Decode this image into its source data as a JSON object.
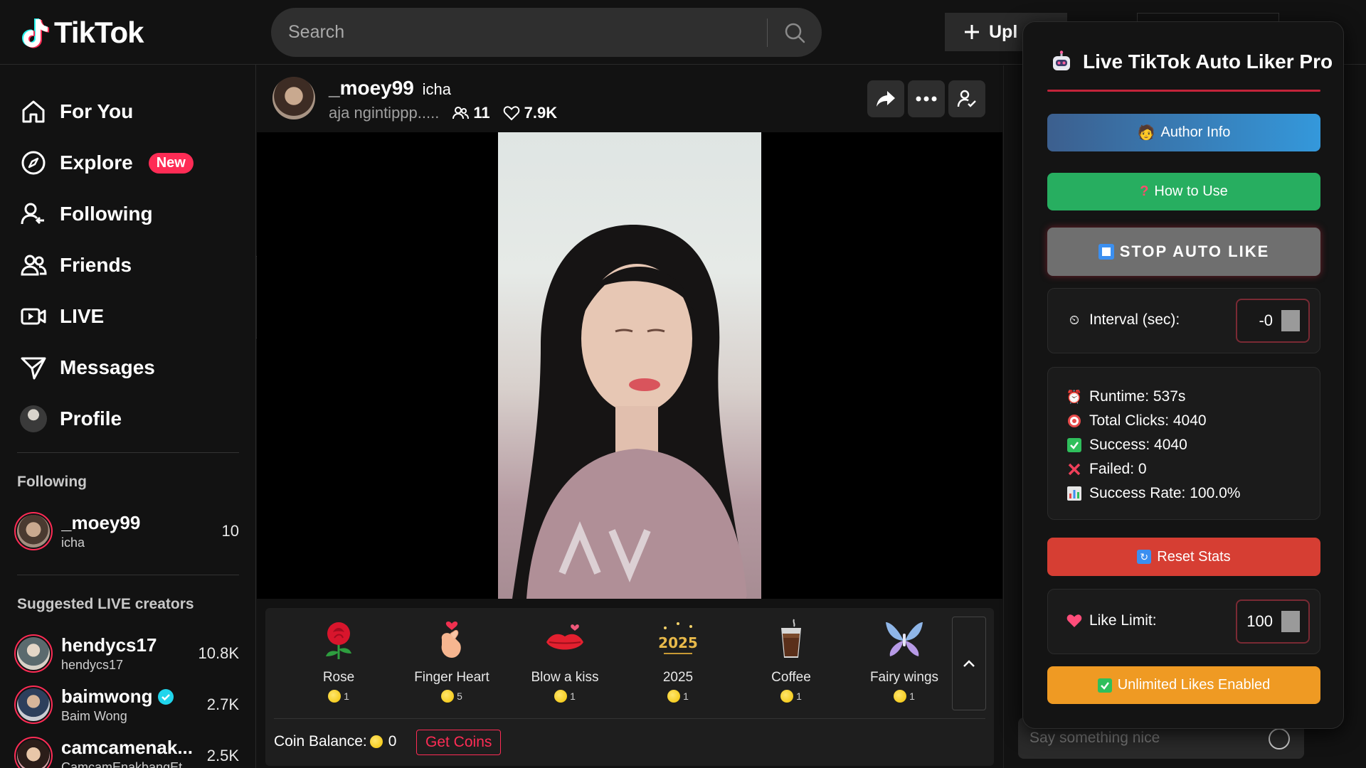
{
  "header": {
    "logo_text": "TikTok",
    "search_placeholder": "Search",
    "upload_label": "Upl"
  },
  "sidebar": {
    "nav": [
      {
        "label": "For You",
        "icon": "home-icon"
      },
      {
        "label": "Explore",
        "icon": "compass-icon",
        "badge": "New"
      },
      {
        "label": "Following",
        "icon": "following-icon"
      },
      {
        "label": "Friends",
        "icon": "friends-icon"
      },
      {
        "label": "LIVE",
        "icon": "live-icon"
      },
      {
        "label": "Messages",
        "icon": "messages-icon"
      },
      {
        "label": "Profile",
        "icon": "profile-avatar"
      }
    ],
    "following_heading": "Following",
    "following": [
      {
        "name": "_moey99",
        "sub": "icha",
        "count": "10"
      }
    ],
    "suggested_heading": "Suggested LIVE creators",
    "suggested": [
      {
        "name": "hendycs17",
        "sub": "hendycs17",
        "count": "10.8K",
        "verified": false
      },
      {
        "name": "baimwong",
        "sub": "Baim Wong",
        "count": "2.7K",
        "verified": true
      },
      {
        "name": "camcamenak...",
        "sub": "CamcamEnakbangEt",
        "count": "2.5K",
        "verified": false
      }
    ]
  },
  "live": {
    "username": "_moey99",
    "nickname": "icha",
    "description": "aja ngintippp.....",
    "viewers": "11",
    "likes": "7.9K"
  },
  "gifts": [
    {
      "name": "Rose",
      "price": "1",
      "icon": "rose-icon"
    },
    {
      "name": "Finger Heart",
      "price": "5",
      "icon": "finger-heart-icon"
    },
    {
      "name": "Blow a kiss",
      "price": "1",
      "icon": "kiss-lips-icon"
    },
    {
      "name": "2025",
      "price": "1",
      "icon": "2025-icon"
    },
    {
      "name": "Coffee",
      "price": "1",
      "icon": "coffee-icon"
    },
    {
      "name": "Fairy wings",
      "price": "1",
      "icon": "fairy-wings-icon"
    }
  ],
  "coins": {
    "balance_label": "Coin Balance:",
    "balance_value": "0",
    "get_coins_label": "Get Coins"
  },
  "chat": {
    "placeholder": "Say something nice"
  },
  "extension": {
    "title": "Live TikTok Auto Liker Pro",
    "author_info_label": "Author Info",
    "how_to_use_label": "How to Use",
    "stop_label": "STOP AUTO LIKE",
    "interval_label": "Interval (sec):",
    "interval_value": "-0",
    "stats": {
      "runtime": "Runtime: 537s",
      "total_clicks": "Total Clicks: 4040",
      "success": "Success: 4040",
      "failed": "Failed: 0",
      "success_rate": "Success Rate: 100.0%"
    },
    "reset_label": "Reset Stats",
    "like_limit_label": "Like Limit:",
    "like_limit_value": "100",
    "unlimited_label": "Unlimited Likes Enabled",
    "colors": {
      "author": "#3498db",
      "howto": "#27ae60",
      "stop": "#6f6f6f",
      "reset": "#d63e33",
      "unlimited": "#ef9a23",
      "accent": "#c3243a"
    }
  },
  "colors": {
    "brand_red": "#fe2c55",
    "background": "#121212"
  }
}
